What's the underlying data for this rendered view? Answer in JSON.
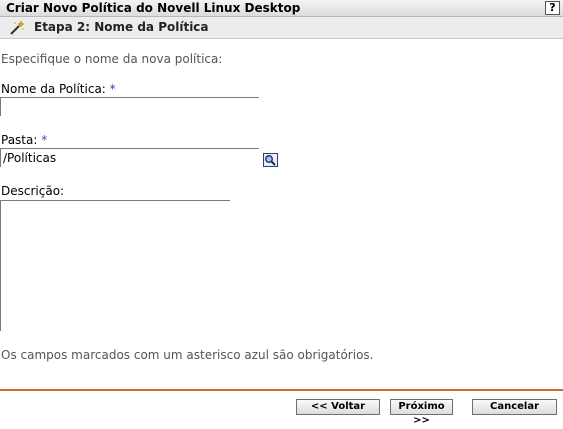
{
  "window": {
    "title": "Criar Novo Política do Novell Linux Desktop",
    "help_label": "?"
  },
  "step": {
    "title": "Etapa 2: Nome da Política",
    "icon": "wand-icon"
  },
  "instructions": "Especifique o nome da nova política:",
  "form": {
    "name_label": "Nome da Política:",
    "name_value": "",
    "folder_label": "Pasta:",
    "folder_value": "/Políticas",
    "folder_browse_icon": "magnifier-icon",
    "description_label": "Descrição:",
    "description_value": "",
    "required_marker": "*"
  },
  "required_note": "Os campos marcados com um asterisco azul são obrigatórios.",
  "buttons": {
    "back": "<< Voltar",
    "next": "Próximo >>",
    "cancel": "Cancelar"
  },
  "colors": {
    "required_marker": "#2a4fa8",
    "divider": "#d26a2a"
  }
}
